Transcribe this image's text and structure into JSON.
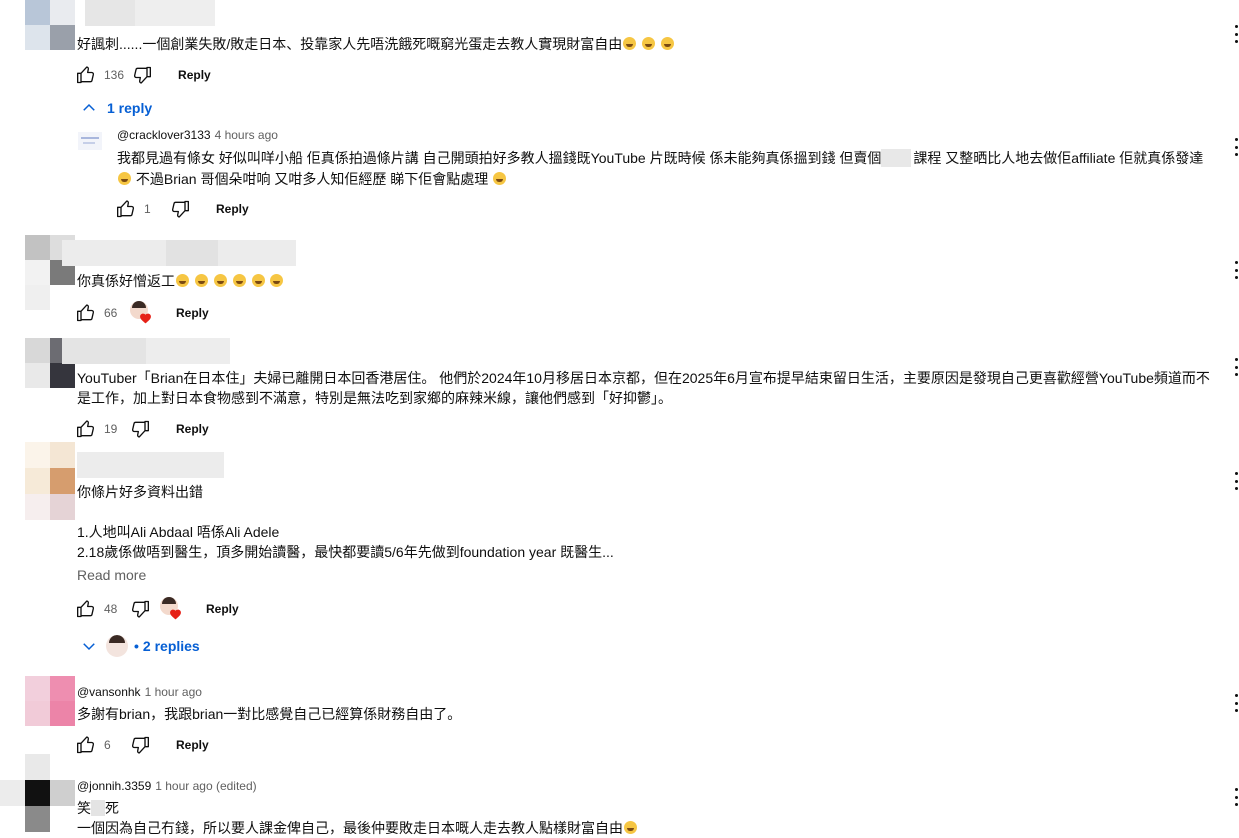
{
  "icons": {
    "like": "thumb-up-outline-icon",
    "dislike": "thumb-down-outline-icon",
    "more": "more-vertical-icon",
    "expand": "chevron-up-icon",
    "collapse": "chevron-down-icon"
  },
  "colors": {
    "link": "#065fd4",
    "meta": "#606060",
    "text": "#0f0f0f"
  },
  "comments": [
    {
      "text": "好諷刺......一個創業失敗/敗走日本、投靠家人先唔洗餓死嘅窮光蛋走去教人實現財富自由",
      "likes": "136",
      "reply": "Reply",
      "replies_toggle": "1 reply",
      "replies": [
        {
          "handle": "@cracklover3133",
          "time": "4 hours ago",
          "text1": "我都見過有條女 好似叫咩小船 佢真係拍過條片講 自己開頭拍好多教人搵錢既YouTube 片既時候 係未能夠真係搵到錢 但賣個",
          "text2": "課程 又整晒比人地去做佢affiliate 佢就真係發達",
          "text3": "不過Brian 哥個朵咁响 又咁多人知佢經歷 睇下佢會點處理",
          "likes": "1",
          "reply": "Reply"
        }
      ]
    },
    {
      "text": "你真係好憎返工",
      "likes": "66",
      "reply": "Reply"
    },
    {
      "text": "YouTuber「Brian在日本住」夫婦已離開日本回香港居住。 他們於2024年10月移居日本京都，但在2025年6月宣布提早結束留日生活，主要原因是發現自己更喜歡經營YouTube頻道而不是工作，加上對日本食物感到不滿意，特別是無法吃到家鄉的麻辣米線，讓他們感到「好抑鬱」。",
      "likes": "19",
      "reply": "Reply"
    },
    {
      "text1": "你條片好多資料出錯",
      "text2": "1.人地叫Ali Abdaal 唔係Ali Adele",
      "text3": "2.18歲係做唔到醫生，頂多開始讀醫，最快都要讀5/6年先做到foundation year 既醫生...",
      "read_more": "Read more",
      "likes": "48",
      "reply": "Reply",
      "replies_toggle": "2 replies"
    },
    {
      "handle": "@vansonhk",
      "time": "1 hour ago",
      "text": "多謝有brian，我跟brian一對比感覺自己已經算係財務自由了。",
      "likes": "6",
      "reply": "Reply"
    },
    {
      "handle": "@jonnih.3359",
      "time": "1 hour ago (edited)",
      "text1a": "笑",
      "text1b": "死",
      "text2": "一個因為自己冇錢，所以要人課金俾自己，最後仲要敗走日本嘅人走去教人點樣財富自由"
    }
  ]
}
